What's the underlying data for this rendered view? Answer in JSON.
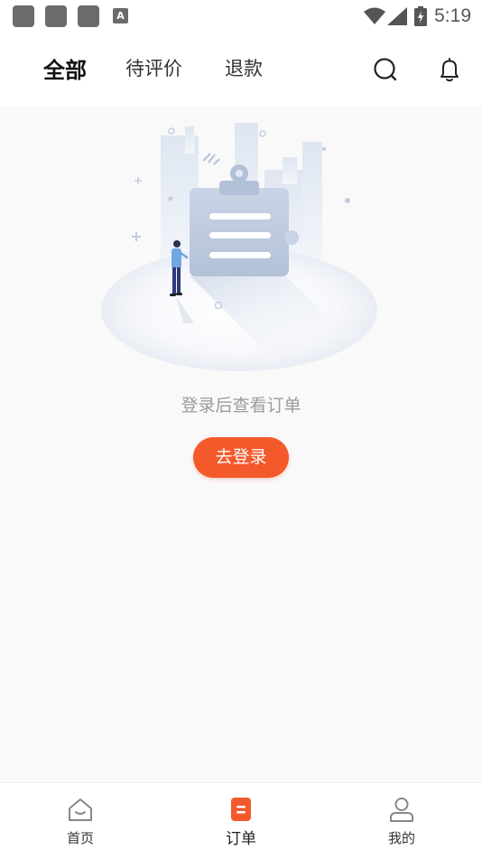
{
  "status_bar": {
    "time": "5:19",
    "left_icons": [
      "app-icon",
      "app-icon",
      "app-icon",
      "keyboard-a-icon"
    ],
    "keyboard_letter": "A",
    "right_icons": [
      "wifi-icon",
      "signal-icon",
      "battery-charging-icon"
    ]
  },
  "header": {
    "tabs": [
      {
        "label": "全部",
        "active": true
      },
      {
        "label": "待评价",
        "active": false
      },
      {
        "label": "退款",
        "active": false
      }
    ],
    "icons": [
      "search-icon",
      "bell-icon"
    ]
  },
  "empty_state": {
    "illustration": "clipboard-empty-illustration",
    "message": "登录后查看订单",
    "button_label": "去登录"
  },
  "bottom_nav": {
    "items": [
      {
        "label": "首页",
        "icon": "home-icon",
        "active": false
      },
      {
        "label": "订单",
        "icon": "order-icon",
        "active": true
      },
      {
        "label": "我的",
        "icon": "profile-icon",
        "active": false
      }
    ]
  },
  "colors": {
    "accent": "#f4592c",
    "background": "#f9f9f9",
    "muted_text": "#9c9c9c"
  }
}
